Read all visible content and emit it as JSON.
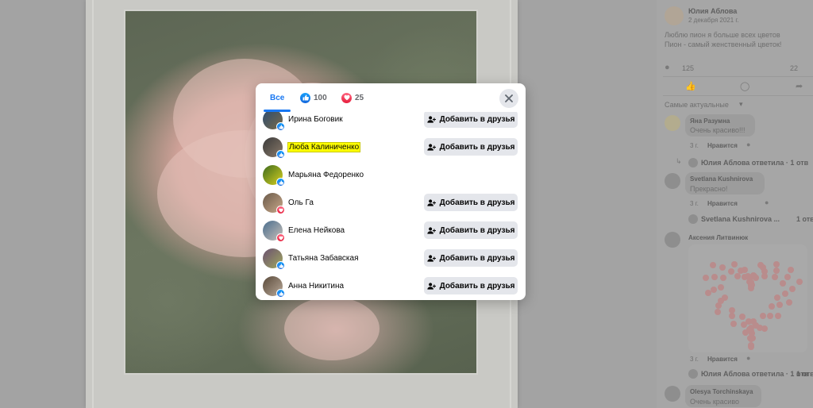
{
  "sidebar": {
    "post_author": "Юлия Аблова",
    "post_date": "2 декабря 2021 г.",
    "post_text_1": "Люблю пион я больше всех цветов",
    "post_text_2": "Пион - самый женственный цветок!",
    "reaction_count": "125",
    "comment_count": "22",
    "sort_label": "Самые актуальные",
    "comments": [
      {
        "author": "Яна Разумна",
        "text": "Очень красиво!!!",
        "time": "3 г.",
        "like": "Нравится"
      },
      {
        "author": "Юлия Аблова ответила · 1 отв",
        "text": "",
        "time": "",
        "like": ""
      },
      {
        "author": "Svetlana Kushnirova",
        "text": "Прекрасно!",
        "time": "3 г.",
        "like": "Нравится"
      },
      {
        "author": "Svetlana Kushnirova ...",
        "text": "",
        "time": "",
        "like": ""
      },
      {
        "author": "Аксения Литвинюк",
        "text": "",
        "time": "3 г.",
        "like": "Нравится"
      },
      {
        "author": "Юлия Аблова ответила · 1 отв",
        "text": "",
        "time": "",
        "like": ""
      },
      {
        "author": "Olesya Torchinskaya",
        "text": "Очень красиво",
        "time": "",
        "like": ""
      }
    ],
    "trailing_text_1": "1 отв",
    "trailing_text_2": "1 отв"
  },
  "modal": {
    "tabs": [
      {
        "label": "Все"
      },
      {
        "label": "100",
        "icon": "like-icon",
        "color": "#1877f2"
      },
      {
        "label": "25",
        "icon": "love-icon",
        "color": "#f33e58"
      }
    ],
    "add_friend_label": "Добавить в друзья",
    "people": [
      {
        "name": "Ирина Боговик",
        "reaction": "like",
        "has_button": true
      },
      {
        "name": "Люба Калиниченко",
        "reaction": "like",
        "has_button": true,
        "highlighted": true
      },
      {
        "name": "Марьяна Федоренко",
        "reaction": "like",
        "has_button": false
      },
      {
        "name": "Оль Га",
        "reaction": "love",
        "has_button": true
      },
      {
        "name": "Елена Нейкова",
        "reaction": "love",
        "has_button": true
      },
      {
        "name": "Татьяна Забавская",
        "reaction": "like",
        "has_button": true
      },
      {
        "name": "Анна Никитина",
        "reaction": "like",
        "has_button": true
      }
    ]
  },
  "colors": {
    "accent": "#1877f2",
    "love": "#f33e58",
    "highlight": "#ffff00"
  }
}
